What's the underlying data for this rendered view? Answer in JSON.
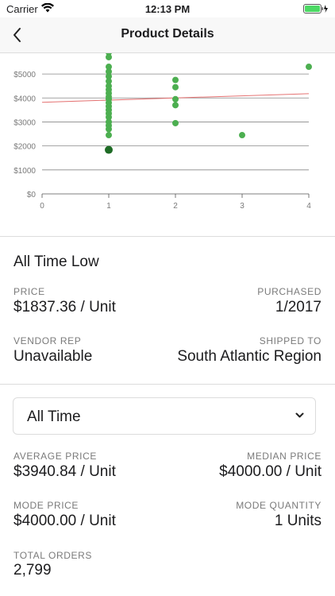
{
  "status": {
    "carrier": "Carrier",
    "time": "12:13 PM"
  },
  "nav": {
    "title": "Product Details"
  },
  "chart_data": {
    "type": "scatter",
    "x_ticks": [
      "0",
      "1",
      "2",
      "3",
      "4"
    ],
    "y_ticks": [
      "$0",
      "$1000",
      "$2000",
      "$3000",
      "$4000",
      "$5000"
    ],
    "xlim": [
      0,
      4
    ],
    "ylim": [
      0,
      5500
    ],
    "grid": true,
    "points": [
      {
        "x": 1,
        "y": 5900
      },
      {
        "x": 1,
        "y": 5700
      },
      {
        "x": 1,
        "y": 5300
      },
      {
        "x": 1,
        "y": 5100
      },
      {
        "x": 1,
        "y": 4900
      },
      {
        "x": 1,
        "y": 4700
      },
      {
        "x": 1,
        "y": 4500
      },
      {
        "x": 1,
        "y": 4350
      },
      {
        "x": 1,
        "y": 4200
      },
      {
        "x": 1,
        "y": 4050
      },
      {
        "x": 1,
        "y": 3950
      },
      {
        "x": 1,
        "y": 3800
      },
      {
        "x": 1,
        "y": 3650
      },
      {
        "x": 1,
        "y": 3500
      },
      {
        "x": 1,
        "y": 3350
      },
      {
        "x": 1,
        "y": 3200
      },
      {
        "x": 1,
        "y": 3000
      },
      {
        "x": 1,
        "y": 2850
      },
      {
        "x": 1,
        "y": 2700
      },
      {
        "x": 1,
        "y": 2450
      },
      {
        "x": 2,
        "y": 4750
      },
      {
        "x": 2,
        "y": 4450
      },
      {
        "x": 2,
        "y": 3950
      },
      {
        "x": 2,
        "y": 3700
      },
      {
        "x": 2,
        "y": 2950
      },
      {
        "x": 3,
        "y": 2450
      },
      {
        "x": 4,
        "y": 5300
      }
    ],
    "highlight_point": {
      "x": 1,
      "y": 1837.36
    },
    "trend_line": {
      "x": [
        0,
        4
      ],
      "y": [
        3820,
        4180
      ]
    },
    "colors": {
      "point": "#4caf50",
      "highlight": "#1e6b25",
      "trend": "#e57373",
      "grid": "#888888"
    }
  },
  "low": {
    "title": "All Time Low",
    "price_label": "PRICE",
    "price_value": "$1837.36 / Unit",
    "purchased_label": "PURCHASED",
    "purchased_value": "1/2017",
    "vendor_label": "VENDOR REP",
    "vendor_value": "Unavailable",
    "shipped_label": "SHIPPED TO",
    "shipped_value": "South Atlantic Region"
  },
  "filter": {
    "selected": "All Time"
  },
  "stats": {
    "avg_label": "AVERAGE PRICE",
    "avg_value": "$3940.84 / Unit",
    "median_label": "MEDIAN PRICE",
    "median_value": "$4000.00 / Unit",
    "mode_label": "MODE PRICE",
    "mode_value": "$4000.00 / Unit",
    "mode_qty_label": "MODE QUANTITY",
    "mode_qty_value": "1 Units",
    "orders_label": "TOTAL ORDERS",
    "orders_value": "2,799"
  }
}
